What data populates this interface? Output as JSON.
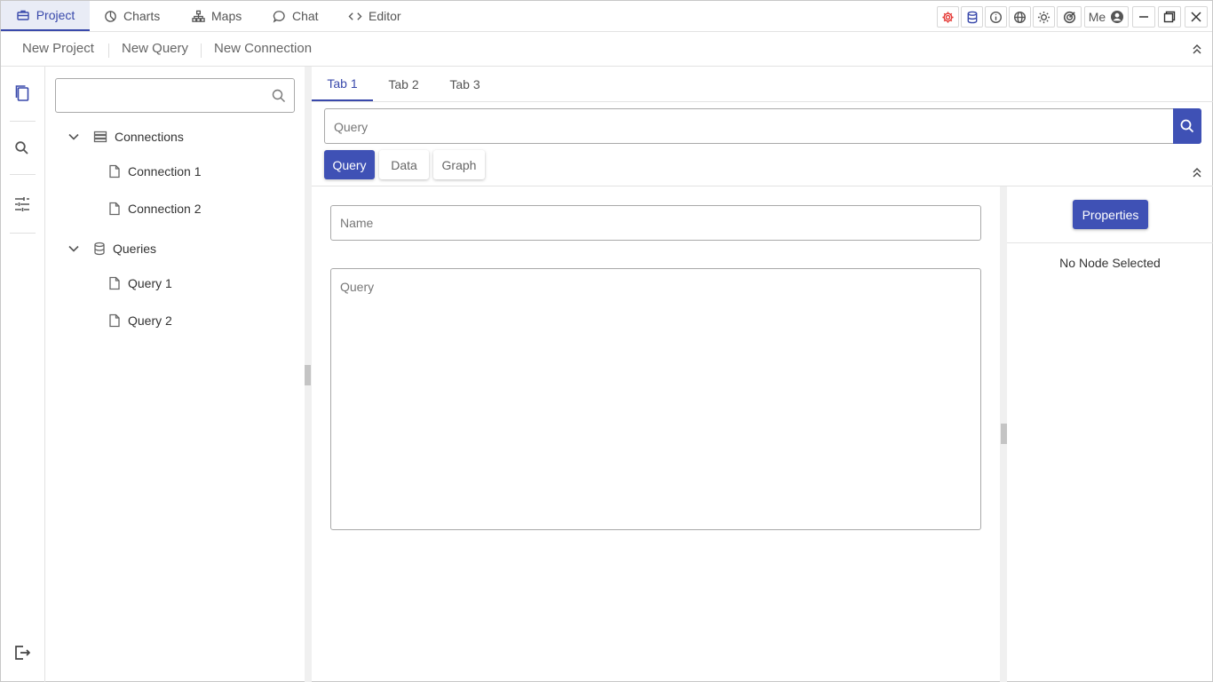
{
  "top_tabs": [
    {
      "label": "Project",
      "icon": "briefcase-icon",
      "active": true
    },
    {
      "label": "Charts",
      "icon": "pie-chart-icon",
      "active": false
    },
    {
      "label": "Maps",
      "icon": "sitemap-icon",
      "active": false
    },
    {
      "label": "Chat",
      "icon": "chat-bubble-icon",
      "active": false
    },
    {
      "label": "Editor",
      "icon": "code-icon",
      "active": false
    }
  ],
  "header_tools": {
    "settings_icon": "gear-icon",
    "database_icon": "database-icon",
    "info_icon": "info-icon",
    "globe_icon": "globe-icon",
    "theme_icon": "sun-icon",
    "target_icon": "target-icon",
    "user_label": "Me",
    "user_icon": "account-circle-icon",
    "settings_color": "#e53935"
  },
  "toolbar": {
    "new_project": "New Project",
    "new_query": "New Query",
    "new_connection": "New Connection"
  },
  "rail_icons": [
    "files-icon",
    "search-icon",
    "sliders-icon",
    "logout-icon"
  ],
  "tree": {
    "search_placeholder": "",
    "connections_label": "Connections",
    "connections": [
      "Connection 1",
      "Connection 2"
    ],
    "queries_label": "Queries",
    "queries": [
      "Query 1",
      "Query 2"
    ]
  },
  "center": {
    "tabs": [
      "Tab 1",
      "Tab 2",
      "Tab 3"
    ],
    "active_tab": "Tab 1",
    "query_placeholder": "Query",
    "modes": [
      "Query",
      "Data",
      "Graph"
    ],
    "active_mode": "Query",
    "name_placeholder": "Name",
    "query_area_placeholder": "Query"
  },
  "props": {
    "button_label": "Properties",
    "status": "No Node Selected"
  },
  "colors": {
    "accent": "#3f51b5",
    "active_tab_bg": "#e9ecf6"
  }
}
